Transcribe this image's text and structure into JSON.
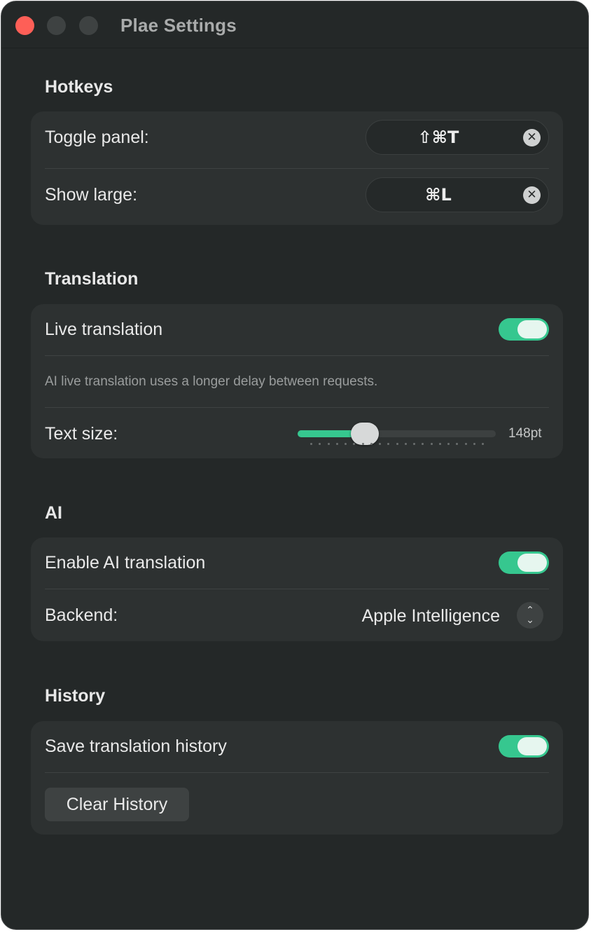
{
  "window": {
    "title": "Plae Settings"
  },
  "sections": {
    "hotkeys": {
      "title": "Hotkeys",
      "toggle_panel": {
        "label": "Toggle panel:",
        "value": "⇧⌘T"
      },
      "show_large": {
        "label": "Show large:",
        "value": "⌘L"
      }
    },
    "translation": {
      "title": "Translation",
      "live": {
        "label": "Live translation",
        "enabled": true
      },
      "note": "AI live translation uses a longer delay between requests.",
      "text_size": {
        "label": "Text size:",
        "value_label": "148pt",
        "fraction": 0.34,
        "ticks": 21
      }
    },
    "ai": {
      "title": "AI",
      "enable": {
        "label": "Enable AI translation",
        "enabled": true
      },
      "backend": {
        "label": "Backend:",
        "value": "Apple Intelligence"
      }
    },
    "history": {
      "title": "History",
      "save": {
        "label": "Save translation history",
        "enabled": true
      },
      "clear_button": "Clear History"
    }
  },
  "colors": {
    "accent": "#36c78f",
    "window_bg": "#242828",
    "card_bg": "#2d3131",
    "close": "#fe5f57"
  },
  "icons": {
    "clear": "x-circle-icon",
    "stepper": "chevron-up-down-icon"
  }
}
